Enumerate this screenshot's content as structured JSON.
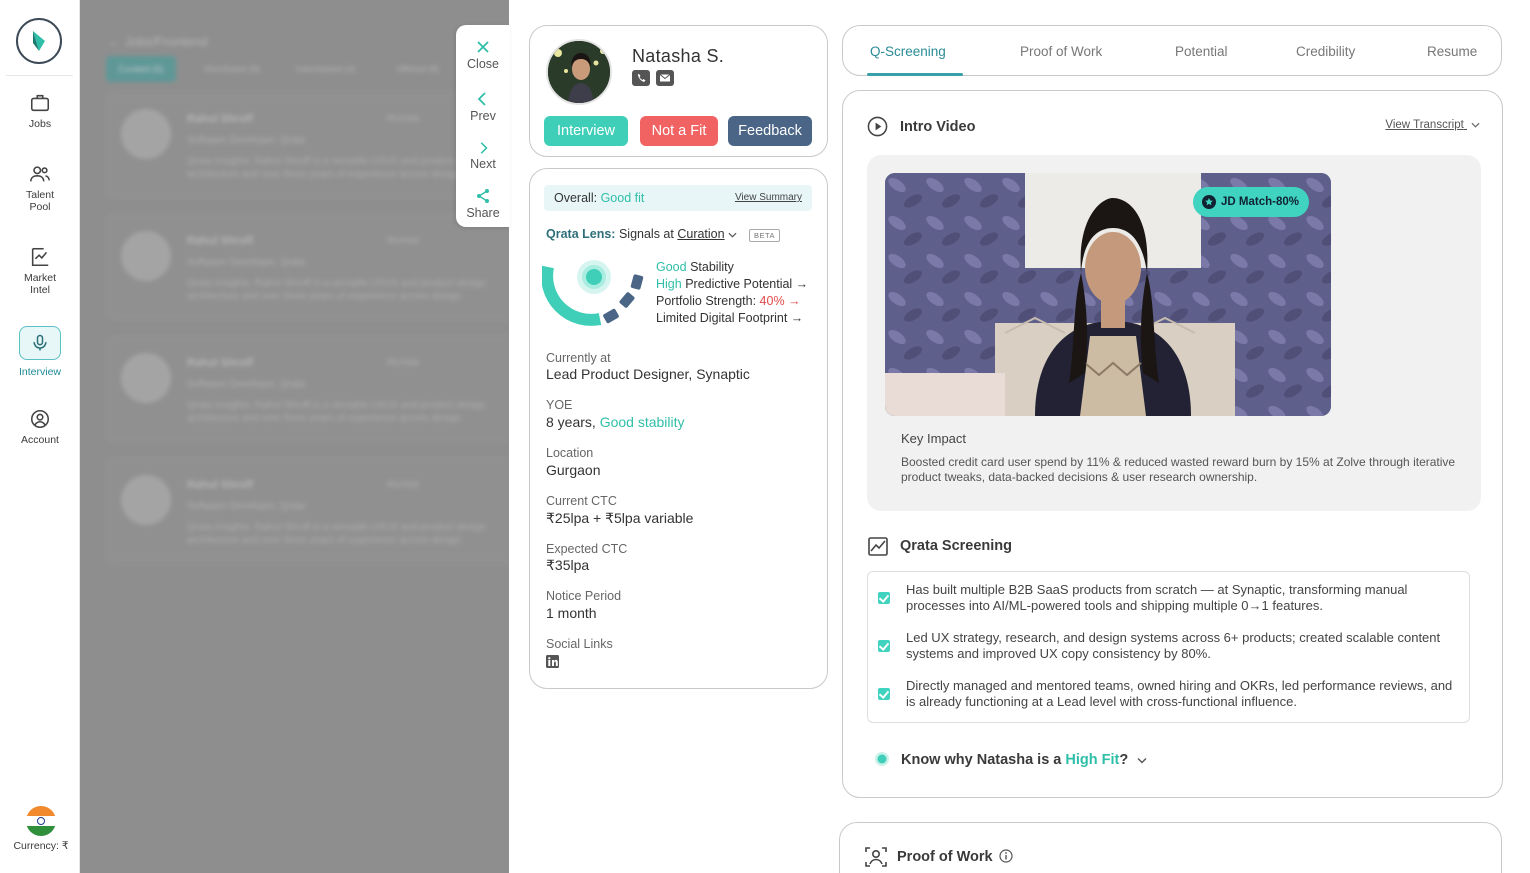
{
  "nav": {
    "items": [
      {
        "label": "Jobs",
        "icon": "briefcase-icon"
      },
      {
        "label": "Talent",
        "label2": "Pool",
        "icon": "users-icon"
      },
      {
        "label": "Market",
        "label2": "Intel",
        "icon": "market-icon"
      },
      {
        "label": "Interview",
        "icon": "mic-icon"
      },
      {
        "label": "Account",
        "icon": "account-icon"
      }
    ],
    "currency": "Currency: ₹"
  },
  "background": {
    "breadcrumb": "← Jobs/Frontend",
    "tabs": [
      "Curated (6)",
      "Shortlisted (9)",
      "Interviewed (4)",
      "Offered (8)"
    ],
    "cards": [
      {
        "name": "Rahul Shroff",
        "role": "Software Developer, Qrata",
        "loc": "Mumbai",
        "insight": "Qrata Insights: Rahul Shroff is a versatile UI/UX and product design architecture and over three years of experience across design"
      },
      {
        "name": "Rahul Shroff",
        "role": "Software Developer, Qrata",
        "loc": "Mumbai",
        "insight": "Qrata Insights: Rahul Shroff is a versatile UI/UX and product design architecture and over three years of experience across design"
      },
      {
        "name": "Rahul Shroff",
        "role": "Software Developer, Qrata",
        "loc": "Mumbai",
        "insight": "Qrata Insights: Rahul Shroff is a versatile UI/UX and product design architecture and over three years of experience across design"
      },
      {
        "name": "Rahul Shroff",
        "role": "Software Developer, Qrata",
        "loc": "Mumbai",
        "insight": "Qrata Insights: Rahul Shroff is a versatile UI/UX and product design architecture and over three years of experience across design"
      }
    ]
  },
  "actions": {
    "close": "Close",
    "prev": "Prev",
    "next": "Next",
    "share": "Share"
  },
  "profile": {
    "name": "Natasha S.",
    "buttons": {
      "interview": "Interview",
      "not_fit": "Not a Fit",
      "feedback": "Feedback"
    }
  },
  "summary": {
    "overall_label": "Overall:",
    "overall_value": "Good fit",
    "view_summary": "View Summary",
    "lens_brand": "Qrata Lens:",
    "lens_text": "Signals at",
    "lens_link": "Curation",
    "beta": "BETA",
    "signals": [
      {
        "prefix": "Good",
        "text": "Stability"
      },
      {
        "prefix": "High",
        "text": "Predictive Potential →"
      },
      {
        "prefix": "Portfolio Strength:",
        "value": "40%",
        "arrow": "→"
      },
      {
        "prefix": "Limited Digital Footprint →"
      }
    ],
    "fields": {
      "current_label": "Currently at",
      "current_value": "Lead Product Designer, Synaptic",
      "yoe_label": "YOE",
      "yoe_value": "8 years,",
      "yoe_tag": "Good stability",
      "loc_label": "Location",
      "loc_value": "Gurgaon",
      "cctc_label": "Current CTC",
      "cctc_value": "₹25lpa + ₹5lpa variable",
      "ectc_label": "Expected CTC",
      "ectc_value": "₹35lpa",
      "notice_label": "Notice Period",
      "notice_value": "1 month",
      "social_label": "Social Links"
    }
  },
  "tabs": [
    "Q-Screening",
    "Proof of Work",
    "Potential",
    "Credibility",
    "Resume"
  ],
  "intro": {
    "title": "Intro Video",
    "view_transcript": "View Transcript",
    "jd_match": "JD Match-80%",
    "key_impact_title": "Key Impact",
    "key_impact_text": "Boosted credit card user spend by 11% & reduced wasted reward burn by 15% at Zolve through iterative product tweaks, data-backed decisions & user research ownership."
  },
  "screening": {
    "title": "Qrata Screening",
    "points": [
      "Has built multiple B2B SaaS products from scratch — at Synaptic, transforming manual processes into AI/ML-powered tools and shipping multiple 0→1 features.",
      "Led UX strategy, research, and design systems across 6+ products; created scalable content systems and improved UX copy consistency by 80%.",
      "Directly managed and mentored teams, owned hiring and OKRs, led performance reviews, and is already functioning at a Lead level with cross-functional influence."
    ],
    "know_prefix": "Know why Natasha is a",
    "know_highlight": "High Fit",
    "know_suffix": "?"
  },
  "proof_of_work": {
    "title": "Proof of Work"
  },
  "colors": {
    "teal": "#2fbfa9",
    "red": "#f16363",
    "navy": "#4a6585",
    "accent": "#3aa0a8"
  }
}
